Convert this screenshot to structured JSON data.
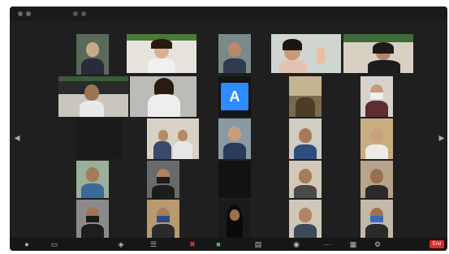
{
  "window": {
    "title": ""
  },
  "tiles": {
    "t_label1": "",
    "t_label2": ""
  },
  "avatar_letter": "A",
  "toolbar": {
    "end_label": "End"
  }
}
